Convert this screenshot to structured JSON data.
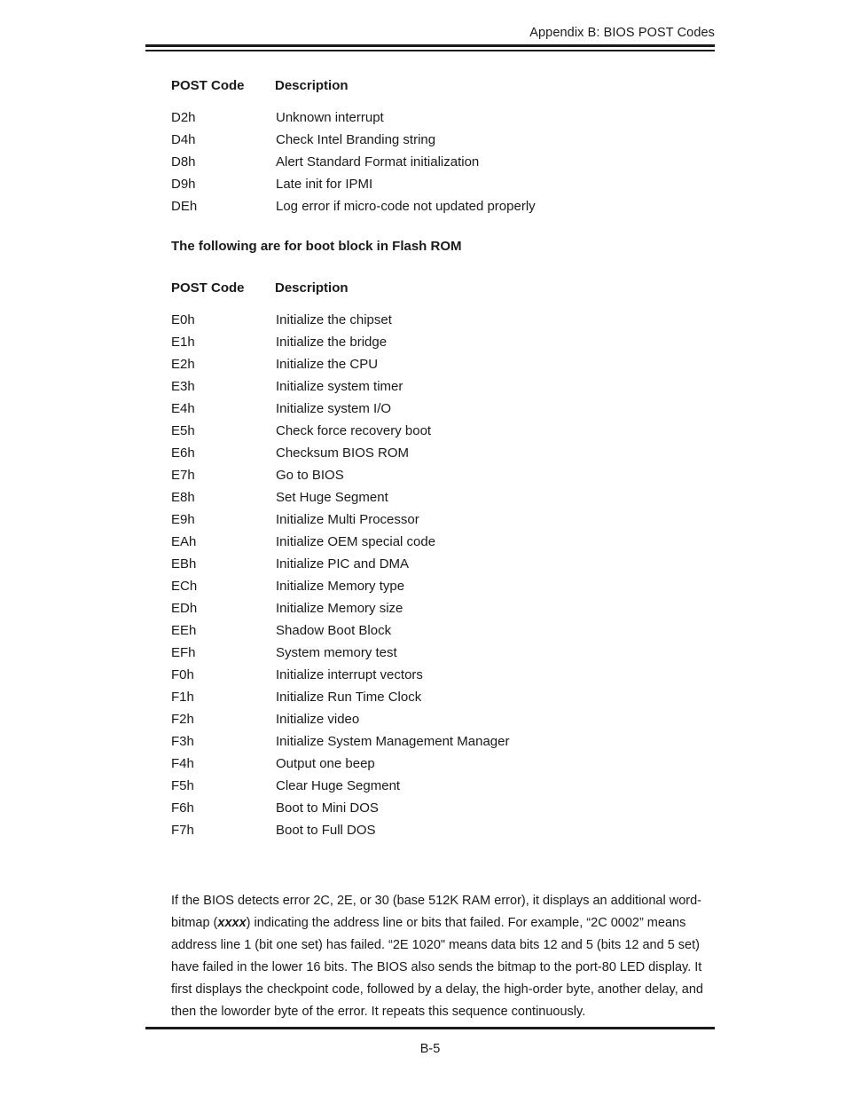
{
  "running_head": "Appendix B: BIOS POST Codes",
  "table_headers": {
    "code": "POST Code",
    "description": "Description"
  },
  "table_1": {
    "rows": [
      {
        "code": "D2h",
        "description": "Unknown interrupt"
      },
      {
        "code": "D4h",
        "description": "Check Intel Branding string"
      },
      {
        "code": "D8h",
        "description": "Alert Standard Format  initialization"
      },
      {
        "code": "D9h",
        "description": "Late init for IPMI"
      },
      {
        "code": "DEh",
        "description": "Log error if micro-code not updated properly"
      }
    ]
  },
  "section_note": "The following are for boot block in Flash ROM",
  "table_2": {
    "rows": [
      {
        "code": "E0h",
        "description": "Initialize the chipset"
      },
      {
        "code": "E1h",
        "description": "Initialize the bridge"
      },
      {
        "code": "E2h",
        "description": "Initialize the CPU"
      },
      {
        "code": "E3h",
        "description": "Initialize system timer"
      },
      {
        "code": "E4h",
        "description": "Initialize system I/O"
      },
      {
        "code": "E5h",
        "description": "Check force recovery boot"
      },
      {
        "code": "E6h",
        "description": "Checksum BIOS ROM"
      },
      {
        "code": "E7h",
        "description": "Go to BIOS"
      },
      {
        "code": "E8h",
        "description": "Set Huge Segment"
      },
      {
        "code": "E9h",
        "description": "Initialize Multi Processor"
      },
      {
        "code": "EAh",
        "description": "Initialize OEM special code"
      },
      {
        "code": "EBh",
        "description": "Initialize PIC and DMA"
      },
      {
        "code": "ECh",
        "description": "Initialize Memory type"
      },
      {
        "code": "EDh",
        "description": "Initialize Memory size"
      },
      {
        "code": "EEh",
        "description": "Shadow Boot Block"
      },
      {
        "code": "EFh",
        "description": "System memory test"
      },
      {
        "code": "F0h",
        "description": "Initialize interrupt vectors"
      },
      {
        "code": "F1h",
        "description": "Initialize Run Time Clock"
      },
      {
        "code": "F2h",
        "description": "Initialize video"
      },
      {
        "code": "F3h",
        "description": "Initialize System Management Manager"
      },
      {
        "code": "F4h",
        "description": "Output one beep"
      },
      {
        "code": "F5h",
        "description": "Clear Huge Segment"
      },
      {
        "code": "F6h",
        "description": "Boot to Mini DOS"
      },
      {
        "code": "F7h",
        "description": "Boot to Full DOS"
      }
    ]
  },
  "paragraph": {
    "part_1": " If the BIOS detects error 2C, 2E, or 30 (base 512K RAM error), it displays an additional word-bitmap (",
    "emphasis": "xxxx",
    "part_2": ") indicating the address line or bits that failed.  For example, “2C 0002” means address line 1 (bit one set) has failed.  “2E 1020\" means data bits 12 and 5 (bits 12 and 5 set) have failed in the lower 16 bits.  The BIOS also sends the bitmap to the port-80 LED display.  It first displays the checkpoint code, followed by a delay, the high-order byte, another delay, and then the loworder byte of the error.  It repeats this sequence continuously."
  },
  "folio": "B-5"
}
